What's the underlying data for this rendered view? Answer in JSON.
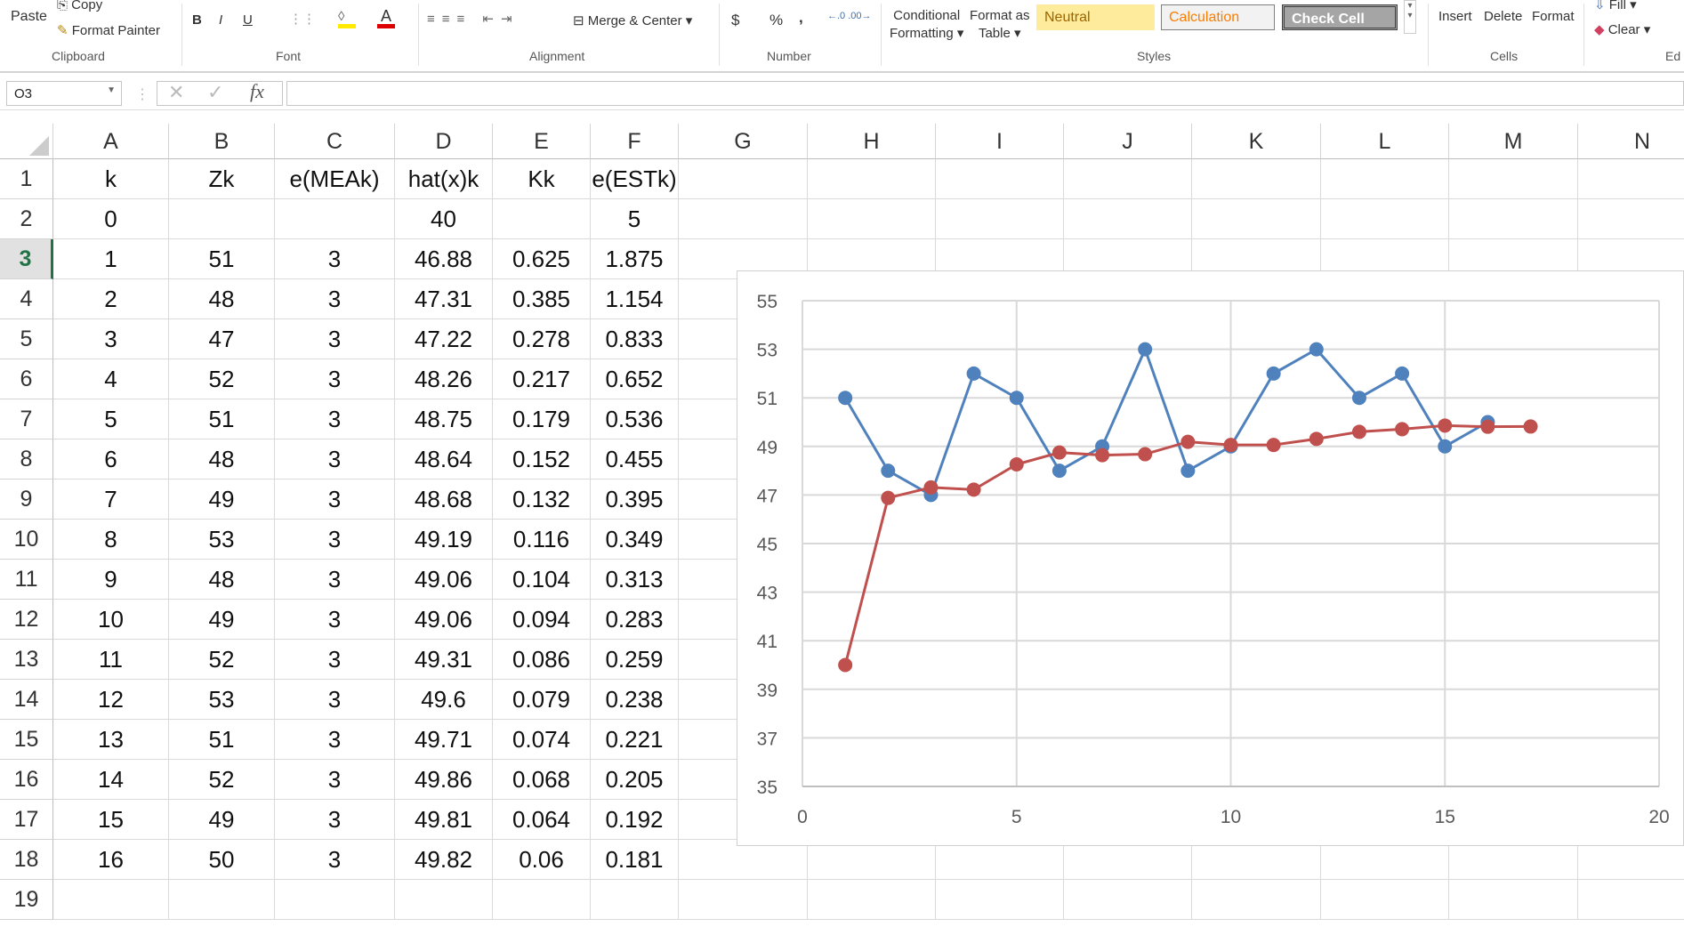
{
  "ribbon": {
    "clipboard": {
      "paste": "Paste",
      "copy": "Copy",
      "format_painter": "Format Painter",
      "label": "Clipboard"
    },
    "font": {
      "bold": "B",
      "italic": "I",
      "underline": "U",
      "label": "Font"
    },
    "alignment": {
      "merge_center": "Merge & Center",
      "label": "Alignment"
    },
    "number": {
      "currency": "$",
      "percent": "%",
      "comma": ",",
      "label": "Number"
    },
    "styles": {
      "conditional_1": "Conditional",
      "conditional_2": "Formatting",
      "format_table_1": "Format as",
      "format_table_2": "Table",
      "neutral": "Neutral",
      "calculation": "Calculation",
      "check_cell": "Check Cell",
      "label": "Styles"
    },
    "cells": {
      "insert": "Insert",
      "delete": "Delete",
      "format": "Format",
      "label": "Cells"
    },
    "editing": {
      "fill": "Fill",
      "clear": "Clear",
      "label": "Ed"
    }
  },
  "formula_bar": {
    "name_box": "O3",
    "fx": "fx",
    "value": ""
  },
  "sheet": {
    "columns": [
      "A",
      "B",
      "C",
      "D",
      "E",
      "F",
      "G",
      "H",
      "I",
      "J",
      "K",
      "L",
      "M",
      "N"
    ],
    "row_numbers": [
      "1",
      "2",
      "3",
      "4",
      "5",
      "6",
      "7",
      "8",
      "9",
      "10",
      "11",
      "12",
      "13",
      "14",
      "15",
      "16",
      "17",
      "18",
      "19"
    ],
    "selected_row": "3",
    "rows": [
      [
        "k",
        "Zk",
        "e(MEAk)",
        "hat(x)k",
        "Kk",
        "e(ESTk)"
      ],
      [
        "0",
        "",
        "",
        "40",
        "",
        "5"
      ],
      [
        "1",
        "51",
        "3",
        "46.88",
        "0.625",
        "1.875"
      ],
      [
        "2",
        "48",
        "3",
        "47.31",
        "0.385",
        "1.154"
      ],
      [
        "3",
        "47",
        "3",
        "47.22",
        "0.278",
        "0.833"
      ],
      [
        "4",
        "52",
        "3",
        "48.26",
        "0.217",
        "0.652"
      ],
      [
        "5",
        "51",
        "3",
        "48.75",
        "0.179",
        "0.536"
      ],
      [
        "6",
        "48",
        "3",
        "48.64",
        "0.152",
        "0.455"
      ],
      [
        "7",
        "49",
        "3",
        "48.68",
        "0.132",
        "0.395"
      ],
      [
        "8",
        "53",
        "3",
        "49.19",
        "0.116",
        "0.349"
      ],
      [
        "9",
        "48",
        "3",
        "49.06",
        "0.104",
        "0.313"
      ],
      [
        "10",
        "49",
        "3",
        "49.06",
        "0.094",
        "0.283"
      ],
      [
        "11",
        "52",
        "3",
        "49.31",
        "0.086",
        "0.259"
      ],
      [
        "12",
        "53",
        "3",
        "49.6",
        "0.079",
        "0.238"
      ],
      [
        "13",
        "51",
        "3",
        "49.71",
        "0.074",
        "0.221"
      ],
      [
        "14",
        "52",
        "3",
        "49.86",
        "0.068",
        "0.205"
      ],
      [
        "15",
        "49",
        "3",
        "49.81",
        "0.064",
        "0.192"
      ],
      [
        "16",
        "50",
        "3",
        "49.82",
        "0.06",
        "0.181"
      ],
      [
        "",
        "",
        "",
        "",
        "",
        ""
      ]
    ]
  },
  "chart_data": {
    "type": "line",
    "xlim": [
      0,
      20
    ],
    "ylim": [
      35,
      55
    ],
    "xticks": [
      "0",
      "5",
      "10",
      "15",
      "20"
    ],
    "yticks": [
      "35",
      "37",
      "39",
      "41",
      "43",
      "45",
      "47",
      "49",
      "51",
      "53",
      "55"
    ],
    "grid": true,
    "series": [
      {
        "color": "#4f81bd",
        "x": [
          1,
          2,
          3,
          4,
          5,
          6,
          7,
          8,
          9,
          10,
          11,
          12,
          13,
          14,
          15,
          16
        ],
        "values": [
          51,
          48,
          47,
          52,
          51,
          48,
          49,
          53,
          48,
          49,
          52,
          53,
          51,
          52,
          49,
          50
        ]
      },
      {
        "color": "#c0504d",
        "x": [
          1,
          2,
          3,
          4,
          5,
          6,
          7,
          8,
          9,
          10,
          11,
          12,
          13,
          14,
          15,
          16,
          17
        ],
        "values": [
          40,
          46.88,
          47.31,
          47.22,
          48.26,
          48.75,
          48.64,
          48.68,
          49.19,
          49.06,
          49.06,
          49.31,
          49.6,
          49.71,
          49.86,
          49.81,
          49.82
        ]
      }
    ]
  }
}
